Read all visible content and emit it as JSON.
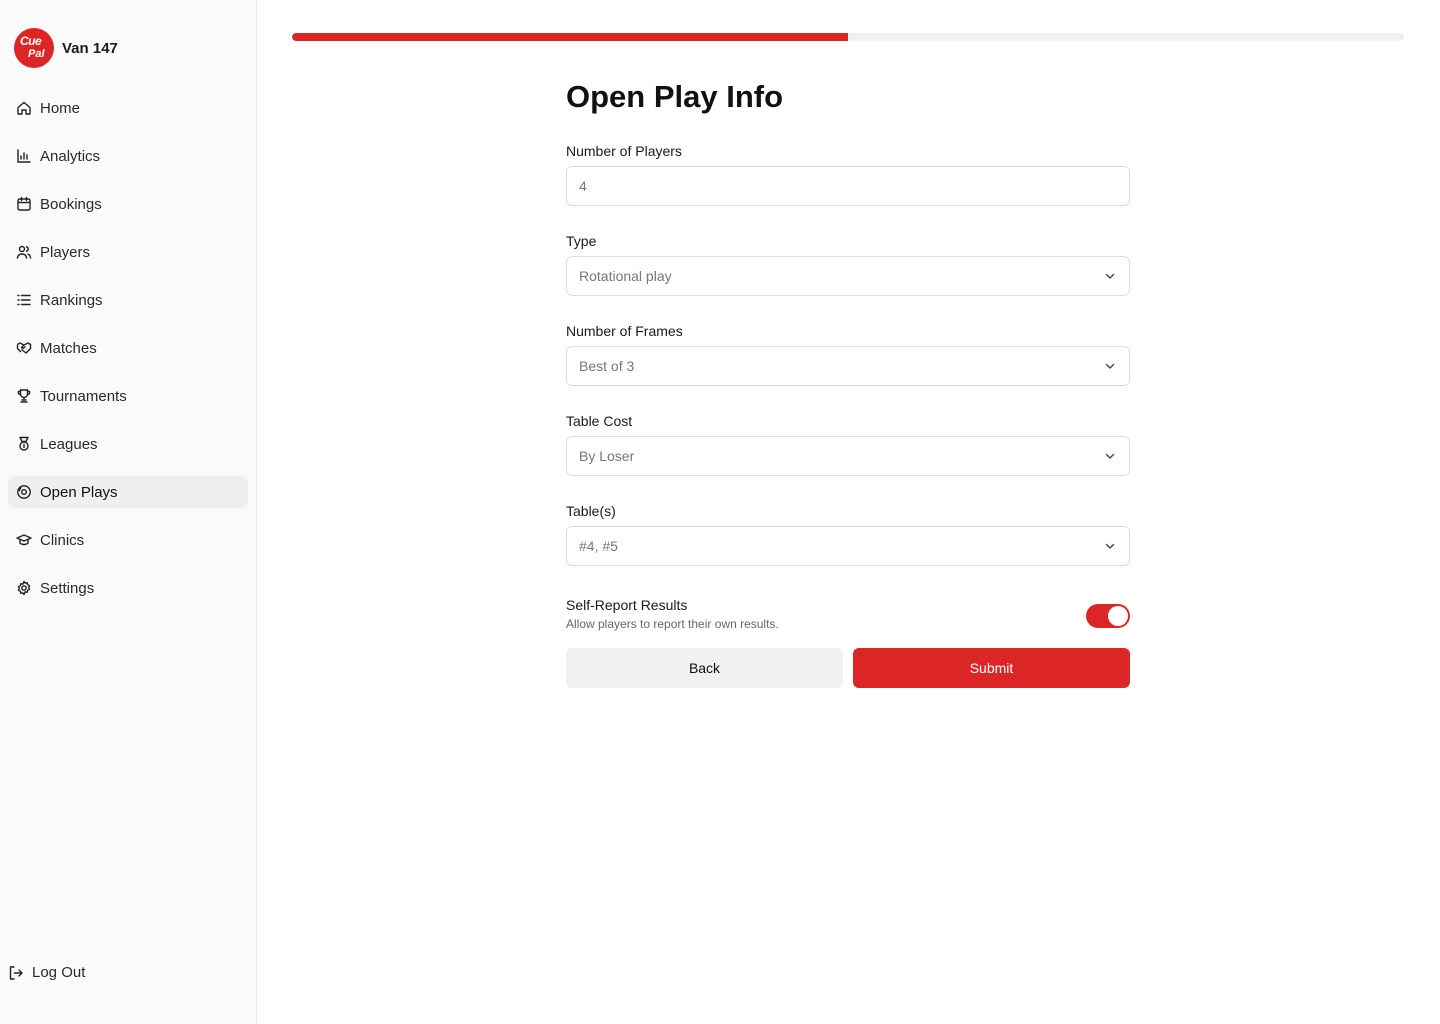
{
  "brand": {
    "logo_line1": "Cue",
    "logo_line2": "Pal",
    "name": "Van 147",
    "accent": "#dc2626"
  },
  "sidebar": {
    "items": [
      {
        "label": "Home",
        "icon": "home-icon"
      },
      {
        "label": "Analytics",
        "icon": "bar-chart-icon"
      },
      {
        "label": "Bookings",
        "icon": "calendar-icon"
      },
      {
        "label": "Players",
        "icon": "users-icon"
      },
      {
        "label": "Rankings",
        "icon": "list-icon"
      },
      {
        "label": "Matches",
        "icon": "handshake-icon"
      },
      {
        "label": "Tournaments",
        "icon": "trophy-icon"
      },
      {
        "label": "Leagues",
        "icon": "medal-icon"
      },
      {
        "label": "Open Plays",
        "icon": "disc-icon",
        "active": true
      },
      {
        "label": "Clinics",
        "icon": "graduation-cap-icon"
      },
      {
        "label": "Settings",
        "icon": "gear-icon"
      }
    ],
    "logout_label": "Log Out"
  },
  "progress": {
    "value": 0.5
  },
  "form": {
    "title": "Open Play Info",
    "players": {
      "label": "Number of Players",
      "value": "4"
    },
    "type": {
      "label": "Type",
      "value": "Rotational play"
    },
    "frames": {
      "label": "Number of Frames",
      "value": "Best of 3"
    },
    "cost": {
      "label": "Table Cost",
      "value": "By Loser"
    },
    "tables": {
      "label": "Table(s)",
      "value": "#4, #5"
    },
    "self_report": {
      "title": "Self-Report Results",
      "subtitle": "Allow players to report their own results.",
      "enabled": true
    },
    "back_label": "Back",
    "submit_label": "Submit"
  }
}
